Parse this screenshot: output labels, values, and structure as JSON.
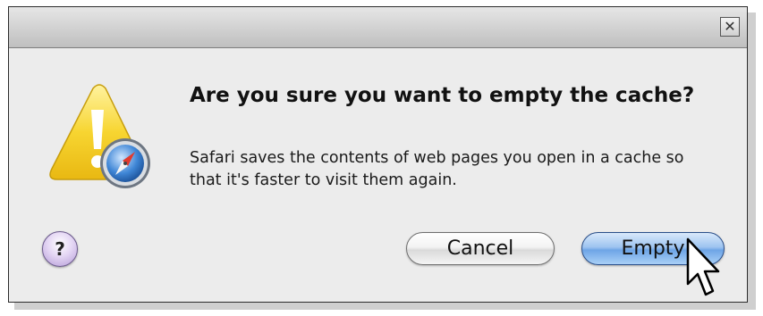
{
  "dialog": {
    "close_glyph": "✕",
    "title": "Are you sure you want to empty the cache?",
    "message": "Safari saves the contents of web pages you open in a cache so that it's faster to visit them again.",
    "help_glyph": "?",
    "buttons": {
      "cancel_label": "Cancel",
      "empty_label": "Empty"
    }
  },
  "icons": {
    "alert": "warning-triangle-with-safari-compass",
    "close": "close-icon",
    "help": "help-icon",
    "cursor": "mouse-pointer"
  },
  "colors": {
    "default_button": "#6ea5e6",
    "warning": "#f7d531",
    "help_button": "#b49bd6"
  }
}
